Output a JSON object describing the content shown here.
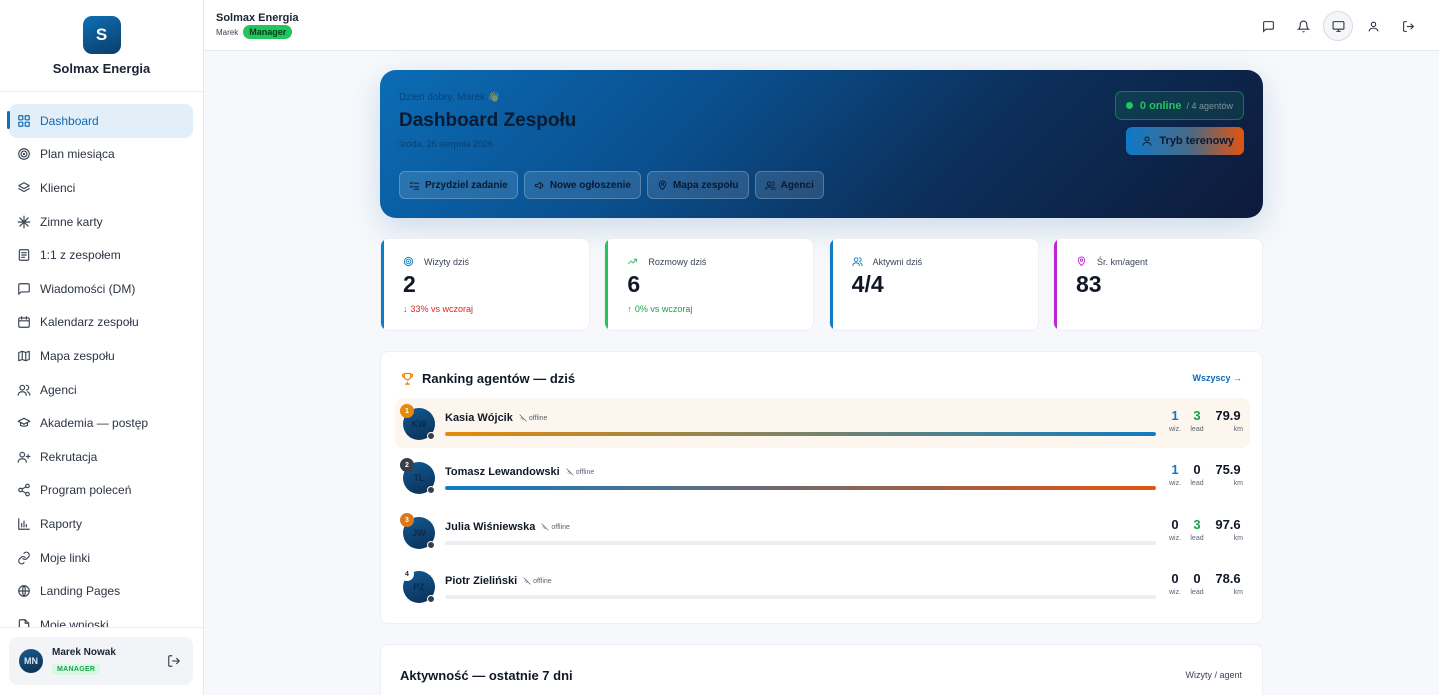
{
  "brand": {
    "initial": "S",
    "name": "Solmax Energia"
  },
  "sidebar": {
    "items": [
      {
        "label": "Dashboard",
        "icon": "grid-icon",
        "active": true
      },
      {
        "label": "Plan miesiąca",
        "icon": "target-icon"
      },
      {
        "label": "Klienci",
        "icon": "layers-icon"
      },
      {
        "label": "Zimne karty",
        "icon": "snowflake-icon"
      },
      {
        "label": "1:1 z zespołem",
        "icon": "notes-icon"
      },
      {
        "label": "Wiadomości (DM)",
        "icon": "chat-icon"
      },
      {
        "label": "Kalendarz zespołu",
        "icon": "calendar-icon"
      },
      {
        "label": "Mapa zespołu",
        "icon": "map-icon"
      },
      {
        "label": "Agenci",
        "icon": "users-icon"
      },
      {
        "label": "Akademia — postęp",
        "icon": "graduation-cap-icon"
      },
      {
        "label": "Rekrutacja",
        "icon": "user-plus-icon"
      },
      {
        "label": "Program poleceń",
        "icon": "share-icon"
      },
      {
        "label": "Raporty",
        "icon": "bar-chart-icon"
      },
      {
        "label": "Moje linki",
        "icon": "link-icon"
      },
      {
        "label": "Landing Pages",
        "icon": "globe-icon"
      },
      {
        "label": "Moje wnioski",
        "icon": "file-icon"
      }
    ]
  },
  "user": {
    "initials": "MN",
    "name": "Marek Nowak",
    "role": "MANAGER"
  },
  "topbar": {
    "title": "Solmax Energia",
    "user": "Marek",
    "role_badge": "Manager"
  },
  "hero": {
    "greeting": "Dzień dobry, Marek 👋",
    "title": "Dashboard Zespołu",
    "date": "środa, 26 sierpnia 2026",
    "actions": [
      {
        "label": "Przydziel zadanie",
        "icon": "list-check-icon"
      },
      {
        "label": "Nowe ogłoszenie",
        "icon": "megaphone-icon"
      },
      {
        "label": "Mapa zespołu",
        "icon": "map-pin-icon"
      },
      {
        "label": "Agenci",
        "icon": "users-icon"
      }
    ],
    "online_count": "0 online",
    "online_total": "/ 4 agentów",
    "field_mode": "Tryb terenowy"
  },
  "kpis": [
    {
      "label": "Wizyty dziś",
      "value": "2",
      "delta": "33% vs wczoraj",
      "trend": "down",
      "color": "#0f7cc4",
      "icon": "target-icon"
    },
    {
      "label": "Rozmowy dziś",
      "value": "6",
      "delta": "0% vs wczoraj",
      "trend": "up",
      "color": "#22c55e",
      "icon": "trend-up-icon"
    },
    {
      "label": "Aktywni dziś",
      "value": "4/4",
      "delta": "",
      "trend": "",
      "color": "#0f7cc4",
      "icon": "users-icon"
    },
    {
      "label": "Śr. km/agent",
      "value": "83",
      "delta": "",
      "trend": "",
      "color": "#c026d3",
      "icon": "map-pin-icon"
    }
  ],
  "ranking": {
    "title": "Ranking agentów — dziś",
    "all_link": "Wszyscy →",
    "status_label": "offline",
    "stat_labels": {
      "visits": "wiz.",
      "leads": "lead",
      "km": "km"
    },
    "agents": [
      {
        "rank": "1",
        "initials": "KW",
        "name": "Kasia Wójcik",
        "visits": "1",
        "leads": "3",
        "km": "79.9",
        "progress": 1.0,
        "rank_color": "#e58a0a",
        "fill": "linear-gradient(90deg,#e58a0a,#0f7cc4)"
      },
      {
        "rank": "2",
        "initials": "TL",
        "name": "Tomasz Lewandowski",
        "visits": "1",
        "leads": "0",
        "km": "75.9",
        "progress": 1.0,
        "rank_color": "#3a3f47",
        "fill": "linear-gradient(90deg,#0f7cc4,#e2540e)"
      },
      {
        "rank": "3",
        "initials": "JW",
        "name": "Julia Wiśniewska",
        "visits": "0",
        "leads": "3",
        "km": "97.6",
        "progress": 0,
        "rank_color": "#d9781c",
        "fill": "#eceef2"
      },
      {
        "rank": "4",
        "initials": "PZ",
        "name": "Piotr Zieliński",
        "visits": "0",
        "leads": "0",
        "km": "78.6",
        "progress": 0,
        "rank_color": "#ffffff",
        "fill": "#eceef2"
      }
    ]
  },
  "activity": {
    "title": "Aktywność — ostatnie 7 dni",
    "meta": "Wizyty / agent"
  }
}
